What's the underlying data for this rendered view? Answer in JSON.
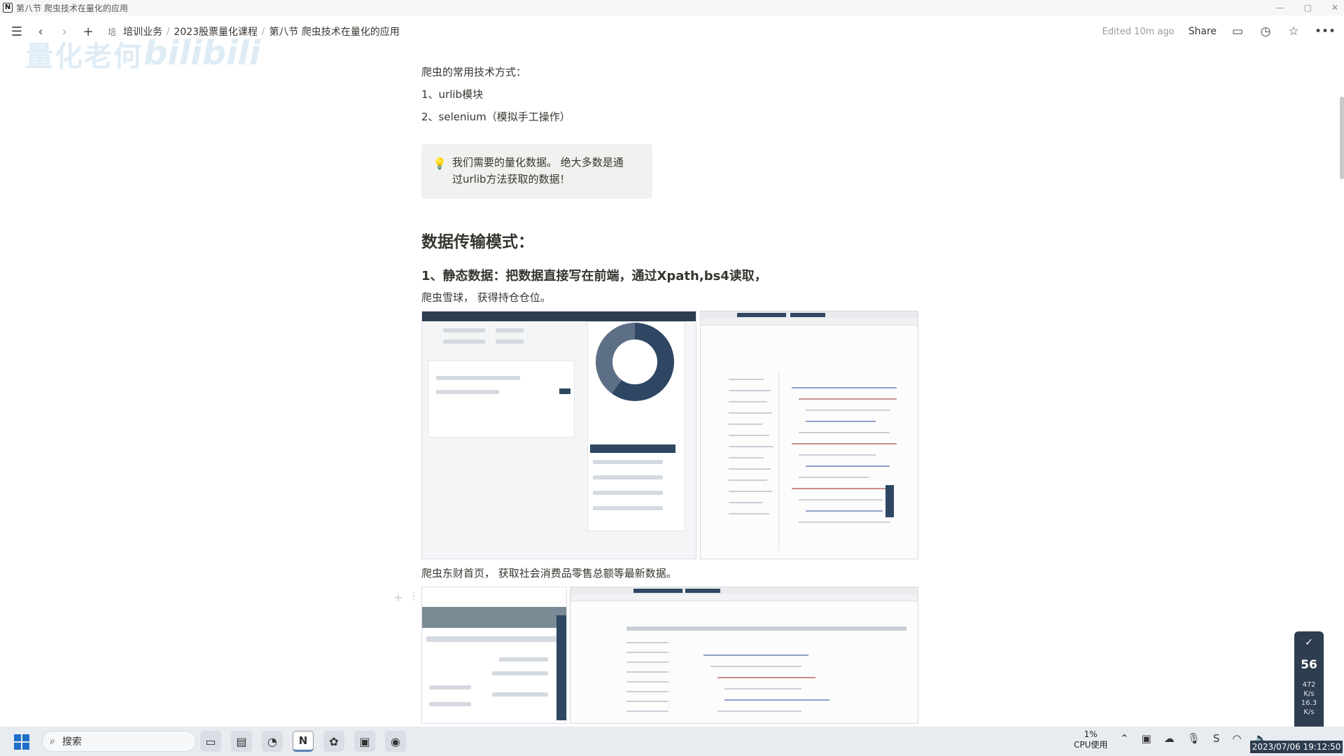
{
  "window": {
    "title": "第八节 爬虫技术在量化的应用",
    "app_icon": "N"
  },
  "topnav": {
    "breadcrumbs": [
      "培训业务",
      "2023股票量化课程",
      "第八节 爬虫技术在量化的应用"
    ],
    "crumb_glyph": "培",
    "edited": "Edited 10m ago",
    "share": "Share"
  },
  "watermark": {
    "text1": "量化老何",
    "text2": "bilibili"
  },
  "content": {
    "lead": "爬虫的常用技术方式：",
    "list": [
      "1、urlib模块",
      "2、selenium（模拟手工操作）"
    ],
    "callout": [
      "我们需要的量化数据。 绝大多数是通",
      "过urlib方法获取的数据！"
    ],
    "heading": "数据传输模式：",
    "subheading": "1、静态数据：把数据直接写在前端，通过Xpath,bs4读取，",
    "caption1": "爬虫雪球， 获得持仓仓位。",
    "caption2": "爬虫东财首页， 获取社会消费品零售总额等最新数据。"
  },
  "speed_widget": {
    "value": "56",
    "up": "472",
    "up_unit": "K/s",
    "down": "16.3",
    "down_unit": "K/s"
  },
  "taskbar": {
    "search_placeholder": "搜索",
    "cpu_value": "1%",
    "cpu_label": "CPU使用",
    "clock": "2023/07/06 19:12:50"
  },
  "colors": {
    "accent": "#2f4763",
    "callout_bg": "#f1f1ef",
    "text": "#37352f"
  },
  "icons": [
    "menu-icon",
    "back-icon",
    "forward-icon",
    "plus-icon",
    "comment-icon",
    "history-icon",
    "star-icon",
    "more-icon",
    "lightbulb-icon",
    "search-icon",
    "checkmark-icon"
  ]
}
